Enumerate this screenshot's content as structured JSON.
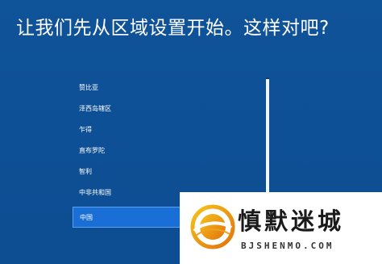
{
  "header": {
    "title": "让我们先从区域设置开始。这样对吧?"
  },
  "region_list": {
    "items": [
      {
        "label": "赞比亚",
        "selected": false
      },
      {
        "label": "泽西岛辖区",
        "selected": false
      },
      {
        "label": "乍得",
        "selected": false
      },
      {
        "label": "直布罗陀",
        "selected": false
      },
      {
        "label": "智利",
        "selected": false
      },
      {
        "label": "中非共和国",
        "selected": false
      },
      {
        "label": "中国",
        "selected": true
      }
    ]
  },
  "watermark": {
    "name": "慎默迷城",
    "sub": "BJSHENMO.COM",
    "logo_icon": "sun-ring-logo-icon"
  },
  "colors": {
    "background": "#0f5399",
    "selected": "#1a6fd6",
    "text": "#ffffff"
  }
}
